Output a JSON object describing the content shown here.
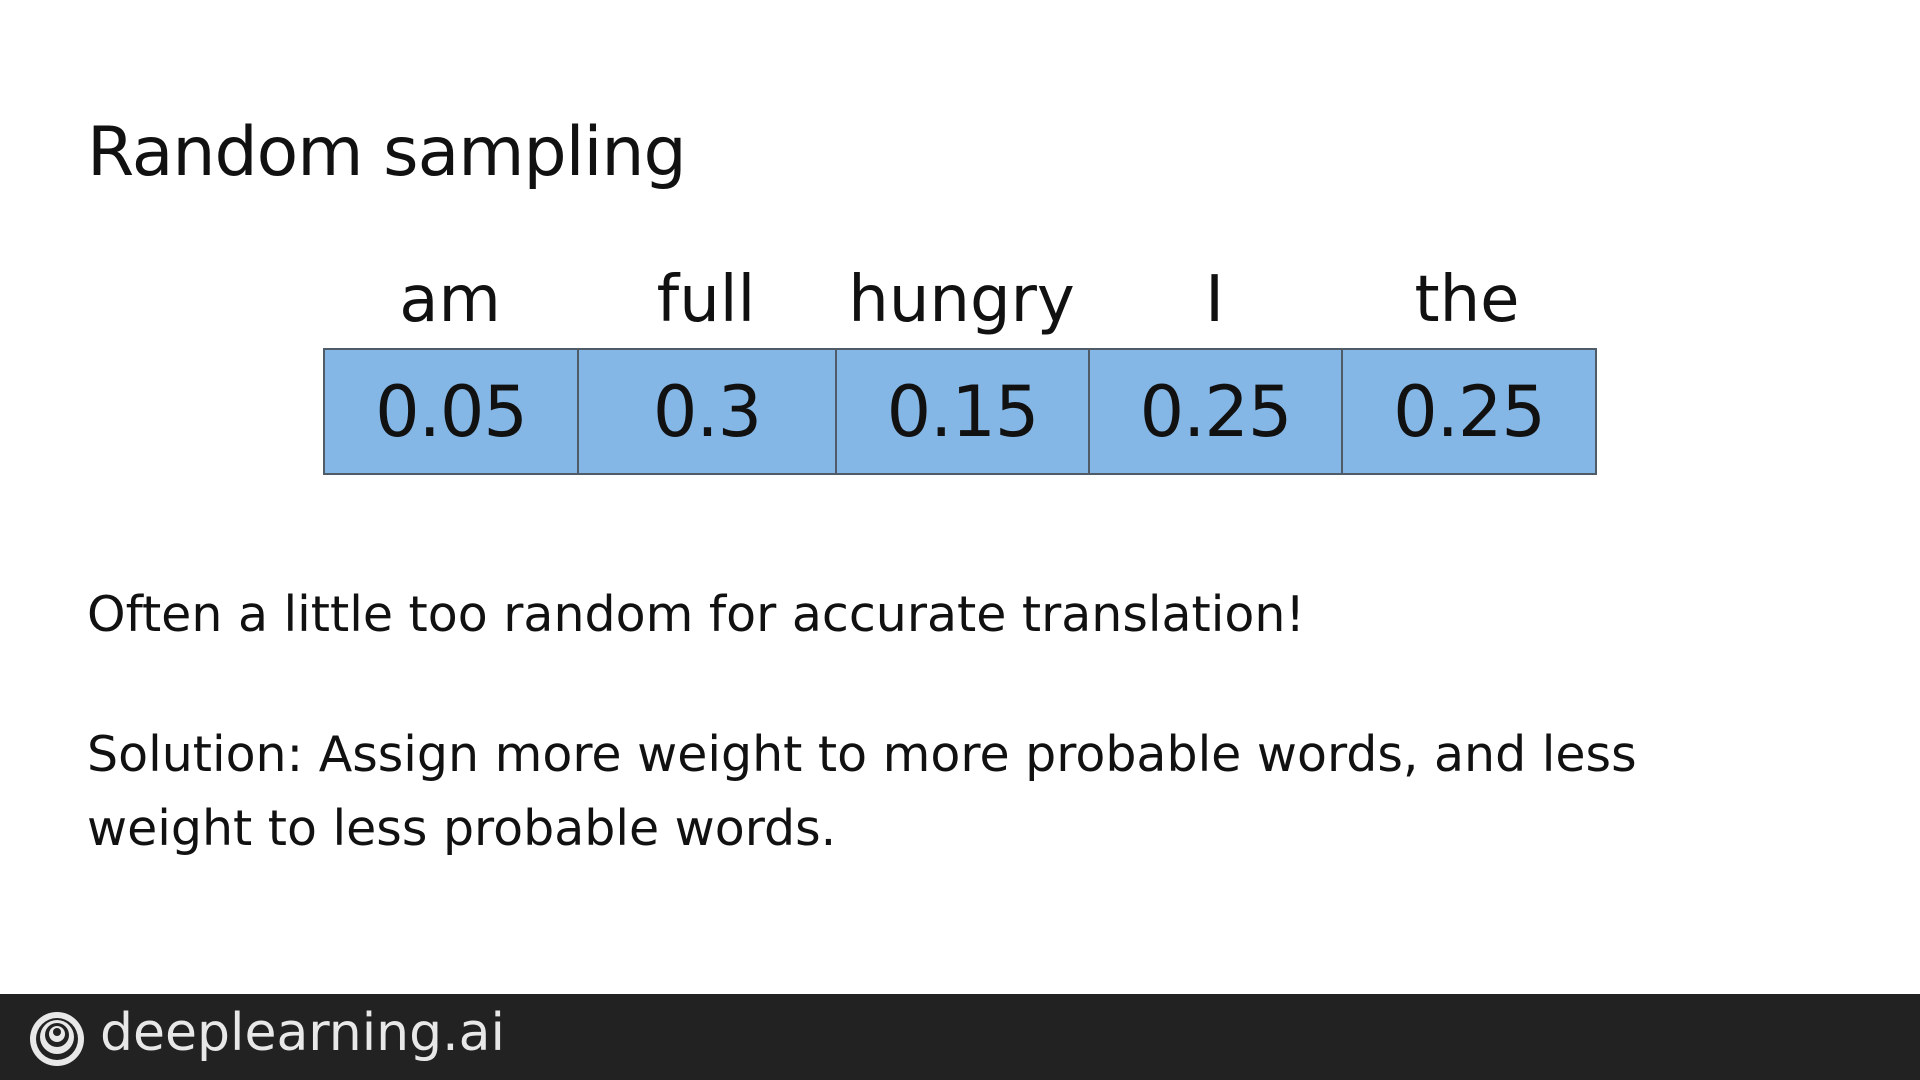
{
  "slide": {
    "title": "Random sampling",
    "vocabulary": [
      {
        "word": "am",
        "probability": "0.05"
      },
      {
        "word": "full",
        "probability": "0.3"
      },
      {
        "word": "hungry",
        "probability": "0.15"
      },
      {
        "word": "I",
        "probability": "0.25"
      },
      {
        "word": "the",
        "probability": "0.25"
      }
    ],
    "note": "Often a little too random for accurate translation!",
    "solution": "Solution: Assign more weight to more probable words, and less weight to less probable words."
  },
  "footer": {
    "brand": "deeplearning.ai",
    "logo_icon": "deeplearning-ai-logo-icon"
  },
  "colors": {
    "cell_fill": "#84b6e6",
    "cell_border": "#4f5b66",
    "footer_bg": "#222222",
    "text": "#111111"
  }
}
